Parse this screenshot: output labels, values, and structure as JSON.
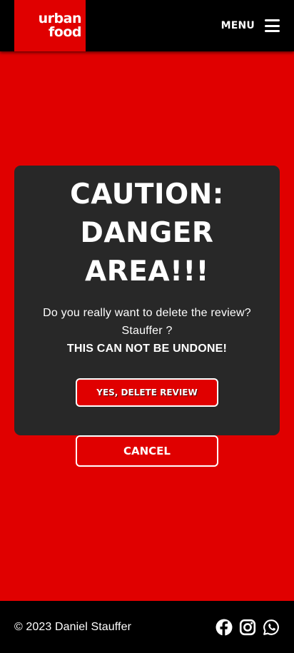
{
  "header": {
    "logo_line1": "urban",
    "logo_line2": "food",
    "menu_label": "MENU",
    "menu_icon": "hamburger-icon"
  },
  "modal": {
    "title_line1": "CAUTION:",
    "title_line2": "DANGER AREA!!!",
    "message_line1": "Do you really want to delete the review?",
    "message_line2": "Stauffer ?",
    "warning": "THIS CAN NOT BE UNDONE!",
    "confirm_label": "YES, DELETE REVIEW",
    "cancel_label": "CANCEL"
  },
  "footer": {
    "copyright": "© 2023 Daniel Stauffer",
    "social_icons": [
      "facebook-icon",
      "instagram-icon",
      "whatsapp-icon"
    ]
  },
  "colors": {
    "brand_red": "#e00000",
    "header_bg": "#000000",
    "modal_bg": "#282828",
    "text": "#ffffff"
  }
}
